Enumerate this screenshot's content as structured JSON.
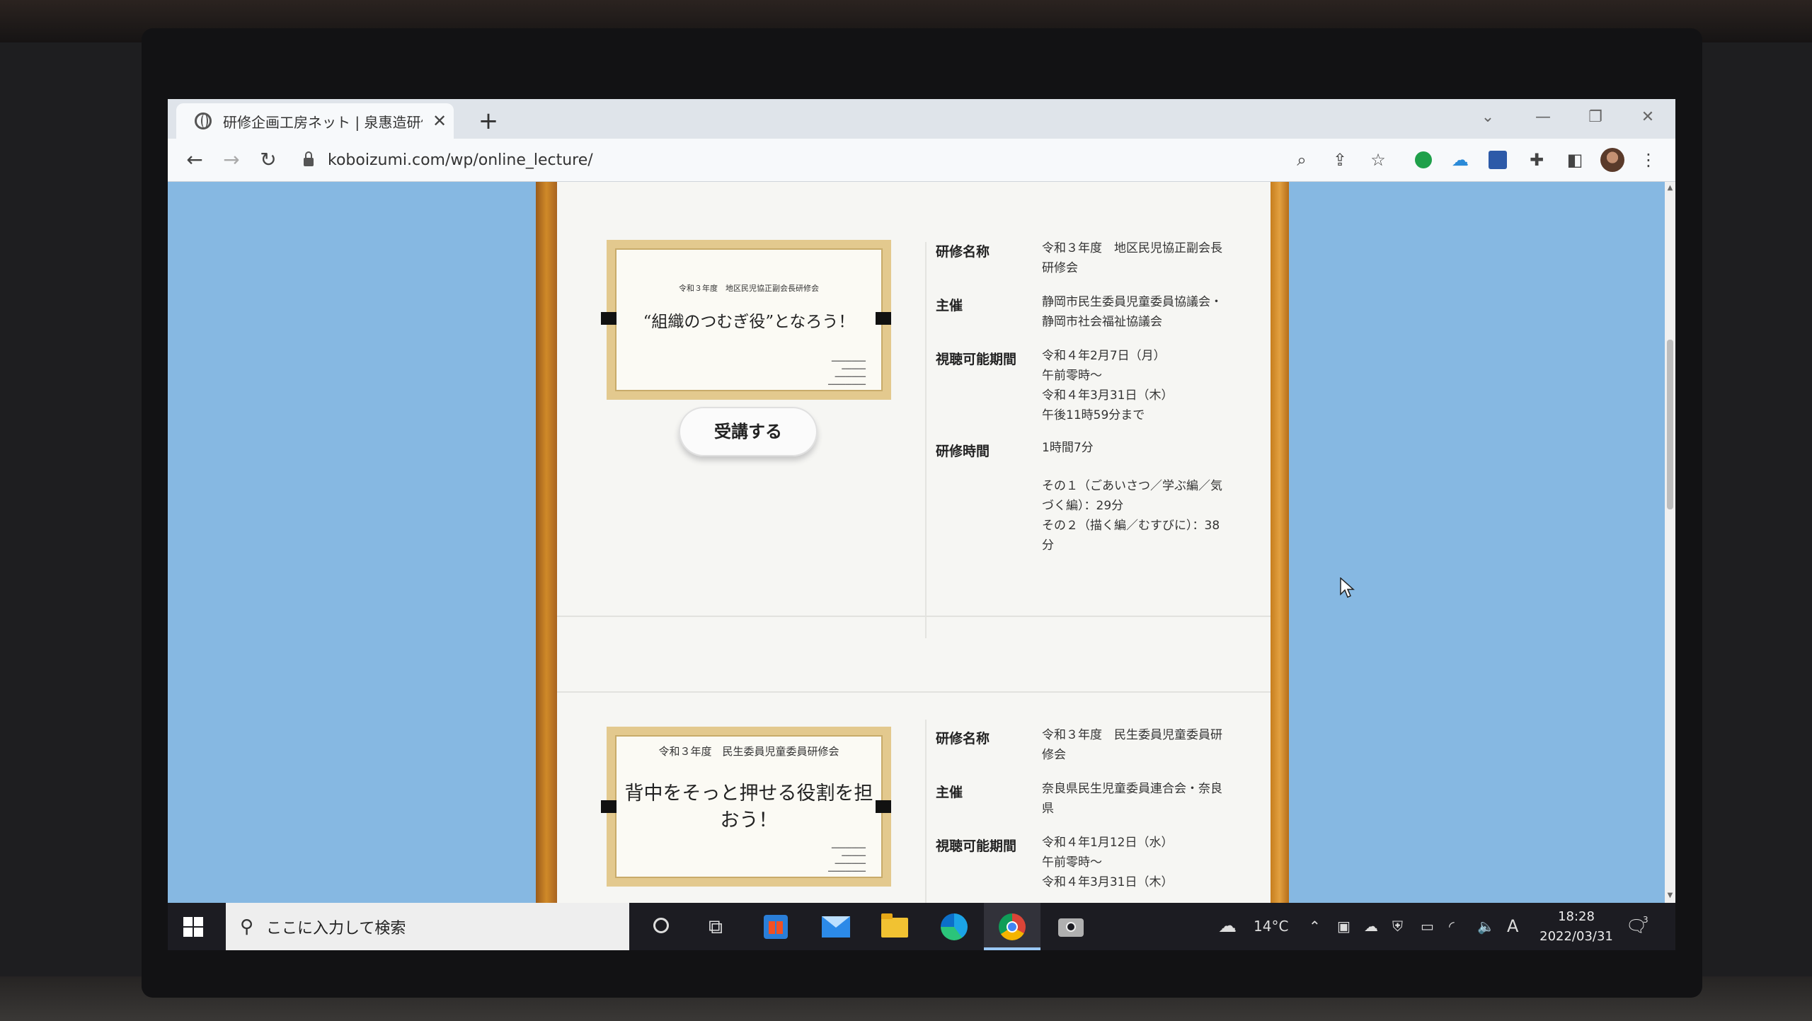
{
  "browser": {
    "tab_title": "研修企画工房ネット | 泉惠造研修",
    "tab_close": "✕",
    "new_tab": "+",
    "url": "koboizumi.com/wp/online_lecture/"
  },
  "lectures": [
    {
      "cert_year": "令和３年度　地区民児協正副会長研修会",
      "cert_title": "“組織のつむぎ役”となろう！",
      "enroll_label": "受講する",
      "name_label": "研修名称",
      "name_value": "令和３年度　地区民児協正副会長研修会",
      "host_label": "主催",
      "host_value": "静岡市民生委員児童委員協議会・静岡市社会福祉協議会",
      "period_label": "視聴可能期間",
      "period_value": [
        "令和４年2月7日（月）",
        "午前零時～",
        "令和４年3月31日（木）",
        "午後11時59分まで"
      ],
      "time_label": "研修時間",
      "time_value": [
        "1時間7分",
        "",
        "その１（ごあいさつ／学ぶ編／気づく編）：29分",
        "その２（描く編／むすびに）：38分"
      ]
    },
    {
      "cert_year": "令和３年度　民生委員児童委員研修会",
      "cert_title": "背中をそっと押せる役割を担おう！",
      "name_label": "研修名称",
      "name_value": "令和３年度　民生委員児童委員研修会",
      "host_label": "主催",
      "host_value": "奈良県民生児童委員連合会・奈良県",
      "period_label": "視聴可能期間",
      "period_value": [
        "令和４年1月12日（水）",
        "午前零時～",
        "令和４年3月31日（木）"
      ]
    }
  ],
  "taskbar": {
    "search_placeholder": "ここに入力して検索",
    "temperature": "14°C",
    "ime": "A",
    "time": "18:28",
    "date": "2022/03/31",
    "notifications": "3"
  }
}
